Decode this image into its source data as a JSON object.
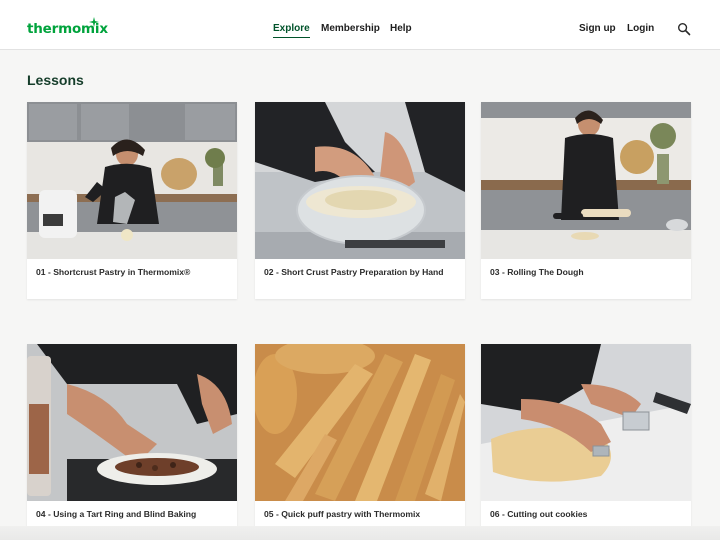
{
  "header": {
    "logo": "thermomix",
    "nav": [
      "Explore",
      "Membership",
      "Help"
    ],
    "active_nav": "Explore",
    "signup": "Sign up",
    "login": "Login",
    "search_icon": "search-icon"
  },
  "page": {
    "title": "Lessons"
  },
  "lessons": [
    {
      "title": "01 - Shortcrust Pastry in Thermomix®"
    },
    {
      "title": "02 - Short Crust Pastry Preparation by Hand"
    },
    {
      "title": "03 - Rolling The Dough"
    },
    {
      "title": "04 - Using a Tart Ring and Blind Baking"
    },
    {
      "title": "05 - Quick puff pastry with Thermomix"
    },
    {
      "title": "06 - Cutting out cookies"
    }
  ],
  "colors": {
    "brand": "#00a33c",
    "title": "#153d2a",
    "background": "#f6f6f5"
  }
}
